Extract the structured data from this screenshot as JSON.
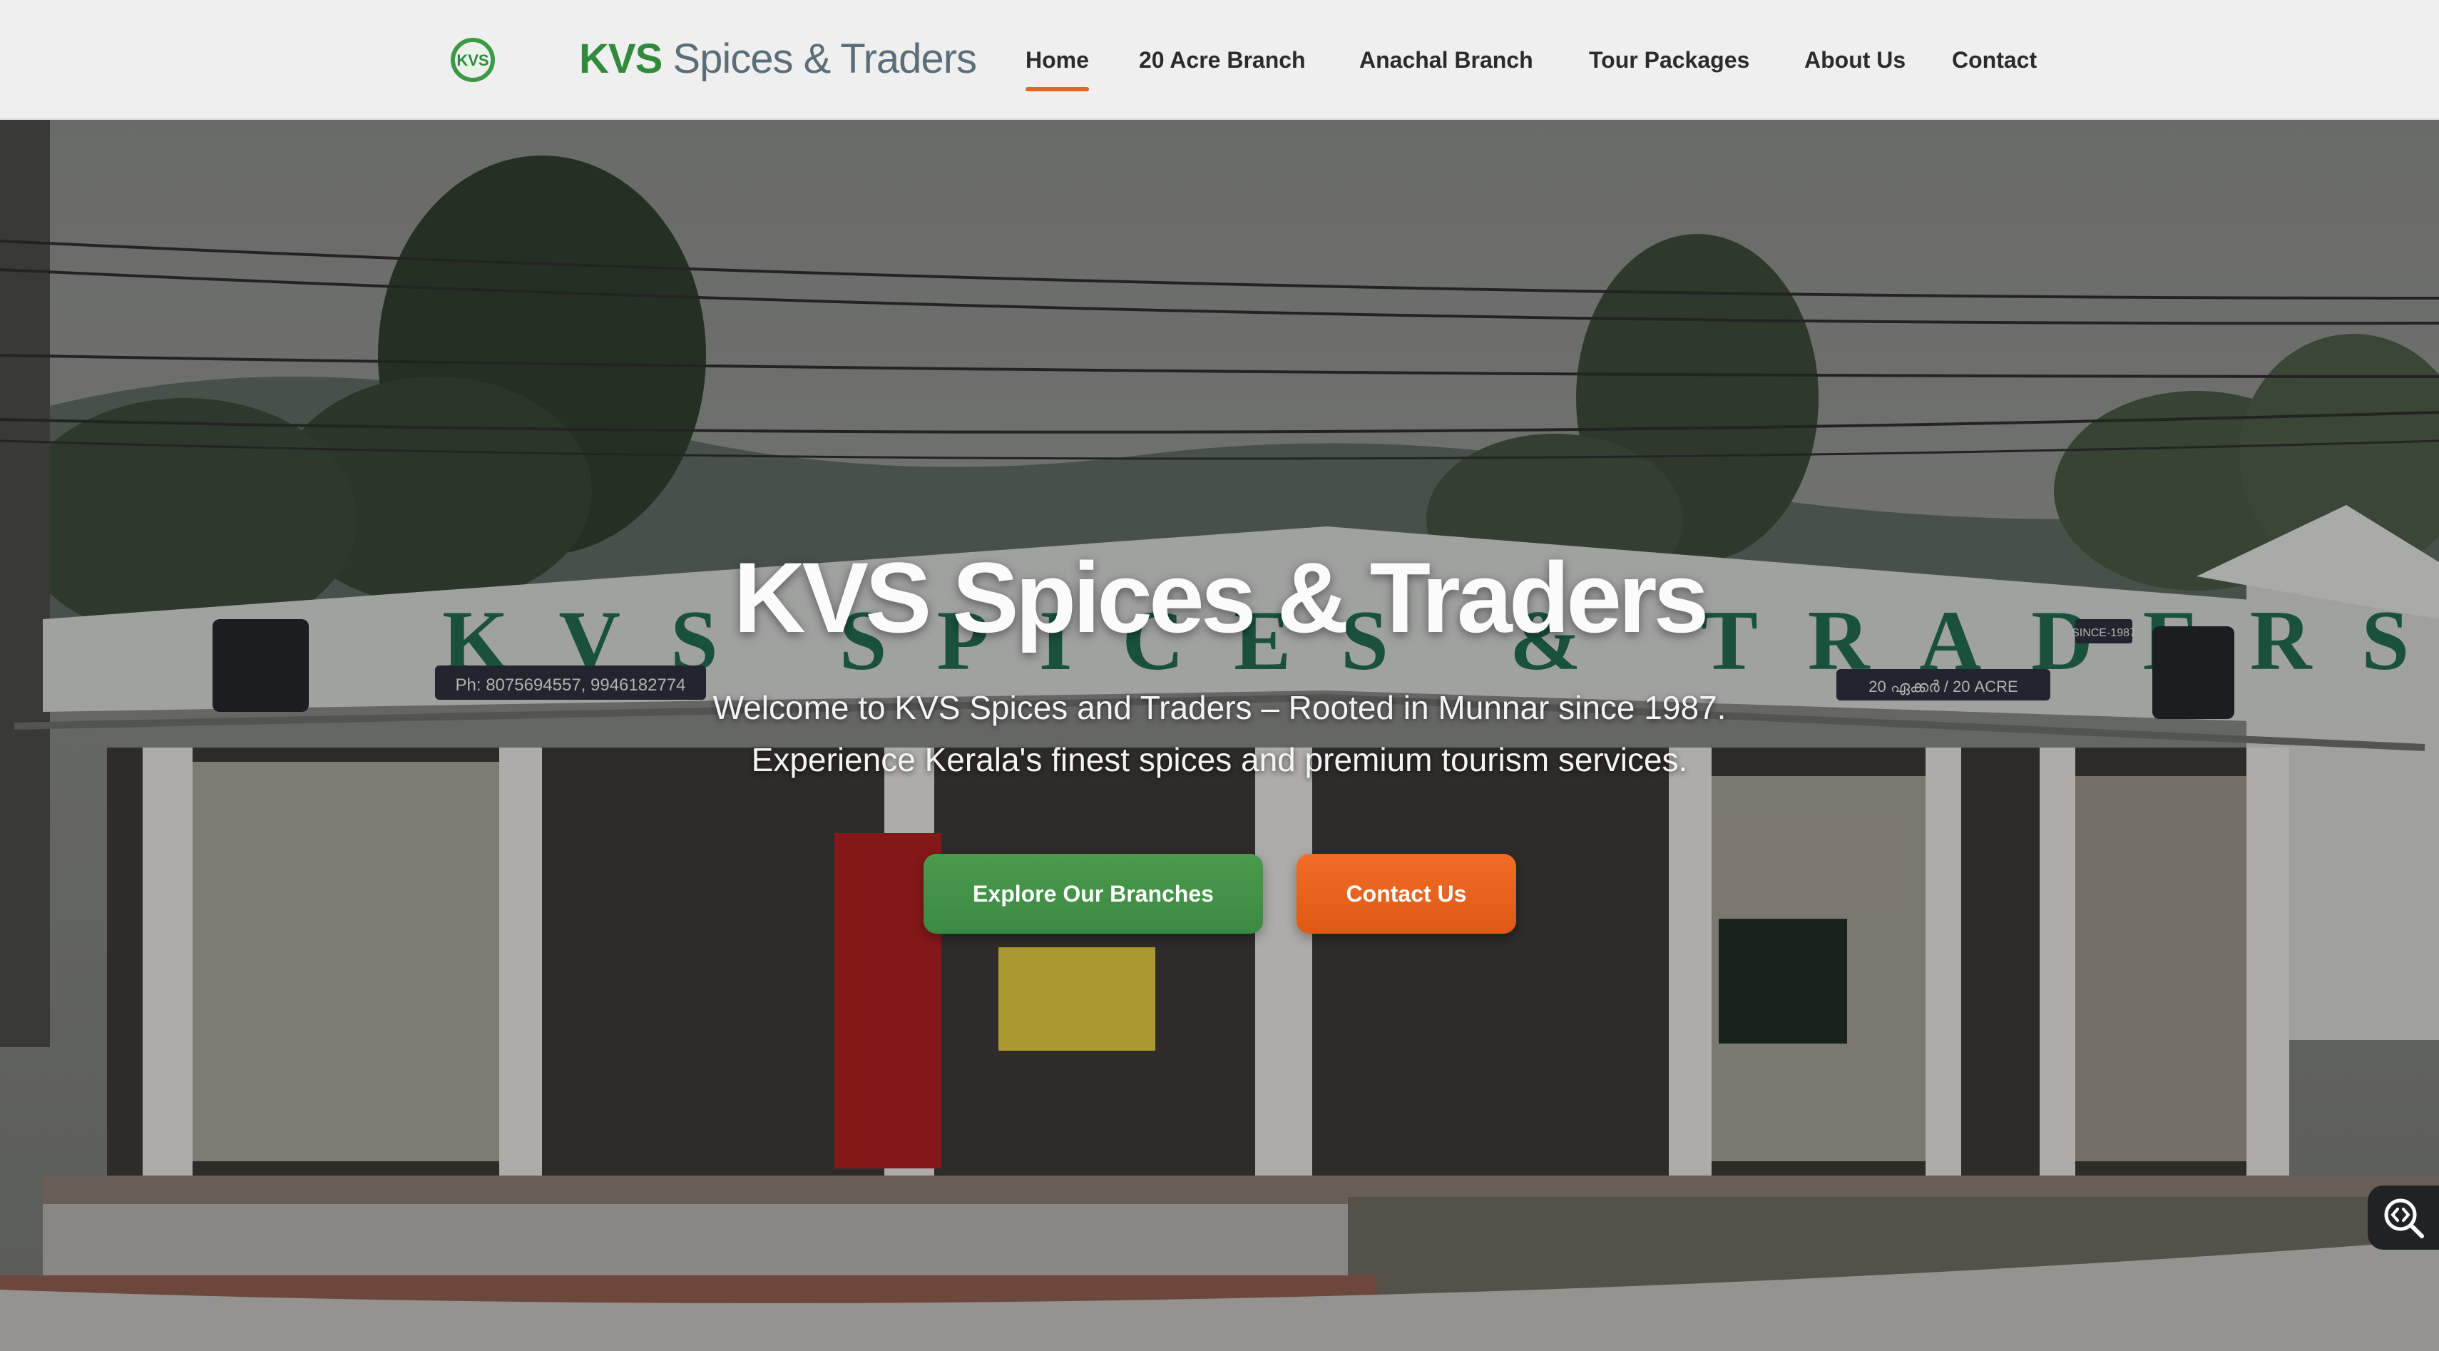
{
  "header": {
    "logo_icon": "kvs-logo-icon",
    "brand_bold": "KVS",
    "brand_rest": " Spices & Traders",
    "nav": [
      {
        "label": "Home",
        "active": true
      },
      {
        "label": "20 Acre Branch"
      },
      {
        "label": "Anachal Branch"
      },
      {
        "label": "Tour Packages"
      },
      {
        "label": "About Us"
      },
      {
        "label": "Contact"
      }
    ]
  },
  "hero": {
    "title": "KVS Spices & Traders",
    "subtitle_line1": "Welcome to KVS Spices and Traders – Rooted in Munnar since 1987.",
    "subtitle_line2": "Experience Kerala's finest spices and premium tourism services.",
    "primary_button": "Explore Our Branches",
    "secondary_button": "Contact Us",
    "photo": {
      "shop_sign_text": "KVS SPICES & TRADERS",
      "phone_text": "Ph: 8075694557, 9946182774",
      "branch_board_text": "20 ഏക്കർ / 20 ACRE",
      "since_text": "SINCE-1987"
    }
  },
  "floating_widget": {
    "icon": "zoom-inspect-icon"
  },
  "colors": {
    "brand_green": "#2f8a3b",
    "accent_orange": "#e8661c",
    "nav_bg": "#efefef",
    "nav_text": "#2b2b2b"
  }
}
